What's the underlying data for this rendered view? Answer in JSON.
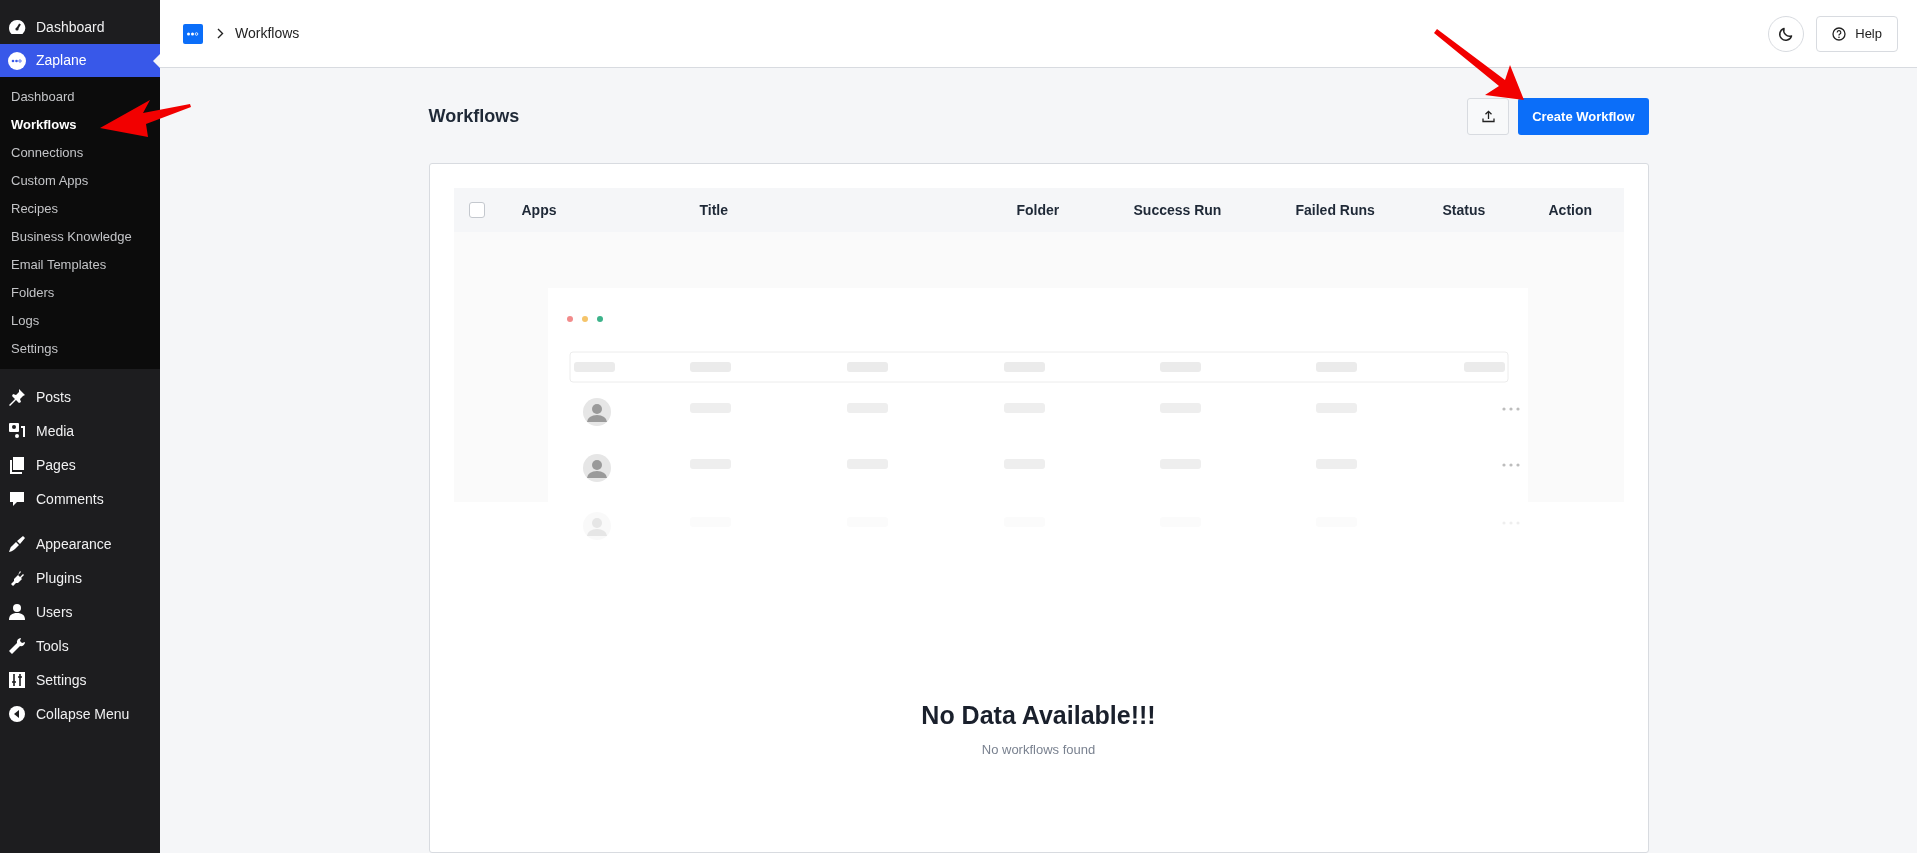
{
  "sidebar": {
    "menu_groups": [
      {
        "items": [
          {
            "label": "Dashboard",
            "selected": false
          },
          {
            "label": "Zaplane",
            "selected": true,
            "children": [
              {
                "label": "Dashboard",
                "selected": false
              },
              {
                "label": "Workflows",
                "selected": true
              },
              {
                "label": "Connections",
                "selected": false
              },
              {
                "label": "Custom Apps",
                "selected": false
              },
              {
                "label": "Recipes",
                "selected": false
              },
              {
                "label": "Business Knowledge",
                "selected": false
              },
              {
                "label": "Email Templates",
                "selected": false
              },
              {
                "label": "Folders",
                "selected": false
              },
              {
                "label": "Logs",
                "selected": false
              },
              {
                "label": "Settings",
                "selected": false
              }
            ]
          }
        ]
      },
      {
        "items": [
          {
            "label": "Posts",
            "selected": false
          },
          {
            "label": "Media",
            "selected": false
          },
          {
            "label": "Pages",
            "selected": false
          },
          {
            "label": "Comments",
            "selected": false
          }
        ]
      },
      {
        "items": [
          {
            "label": "Appearance",
            "selected": false
          },
          {
            "label": "Plugins",
            "selected": false
          },
          {
            "label": "Users",
            "selected": false
          },
          {
            "label": "Tools",
            "selected": false
          },
          {
            "label": "Settings",
            "selected": false
          }
        ]
      }
    ],
    "collapse": "Collapse Menu"
  },
  "topbar": {
    "breadcrumb": "Workflows",
    "help": "Help"
  },
  "page": {
    "title": "Workflows",
    "create_button": "Create Workflow"
  },
  "table": {
    "select_all": {
      "checked": false
    },
    "columns": [
      "Apps",
      "Title",
      "Folder",
      "Success Run",
      "Failed Runs",
      "Status",
      "Action"
    ]
  },
  "empty_state": {
    "title": "No Data Available!!!",
    "subtitle": "No workflows found"
  }
}
